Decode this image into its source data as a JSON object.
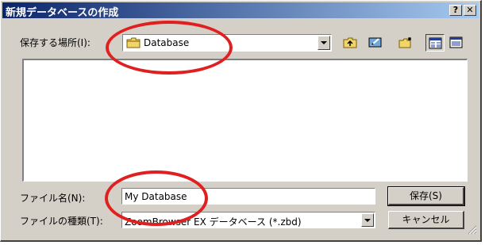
{
  "window": {
    "title": "新規データベースの作成",
    "help_label": "?",
    "close_label": "✕"
  },
  "location": {
    "label": "保存する場所(I):",
    "value": "Database",
    "folder_icon": "folder-icon"
  },
  "toolbar": {
    "buttons": [
      {
        "name": "up-one-level-icon"
      },
      {
        "name": "desktop-icon"
      },
      {
        "name": "new-folder-icon"
      },
      {
        "name": "list-view-icon"
      },
      {
        "name": "details-view-icon"
      }
    ]
  },
  "filename": {
    "label": "ファイル名(N):",
    "value": "My Database"
  },
  "filetype": {
    "label": "ファイルの種類(T):",
    "value": "ZoomBrowser EX データベース (*.zbd)"
  },
  "buttons": {
    "save": "保存(S)",
    "cancel": "キャンセル"
  },
  "colors": {
    "dialog_bg": "#d4d0c8",
    "title_start": "#0a246a",
    "title_end": "#a6caf0",
    "annotation_red": "#e02020"
  }
}
